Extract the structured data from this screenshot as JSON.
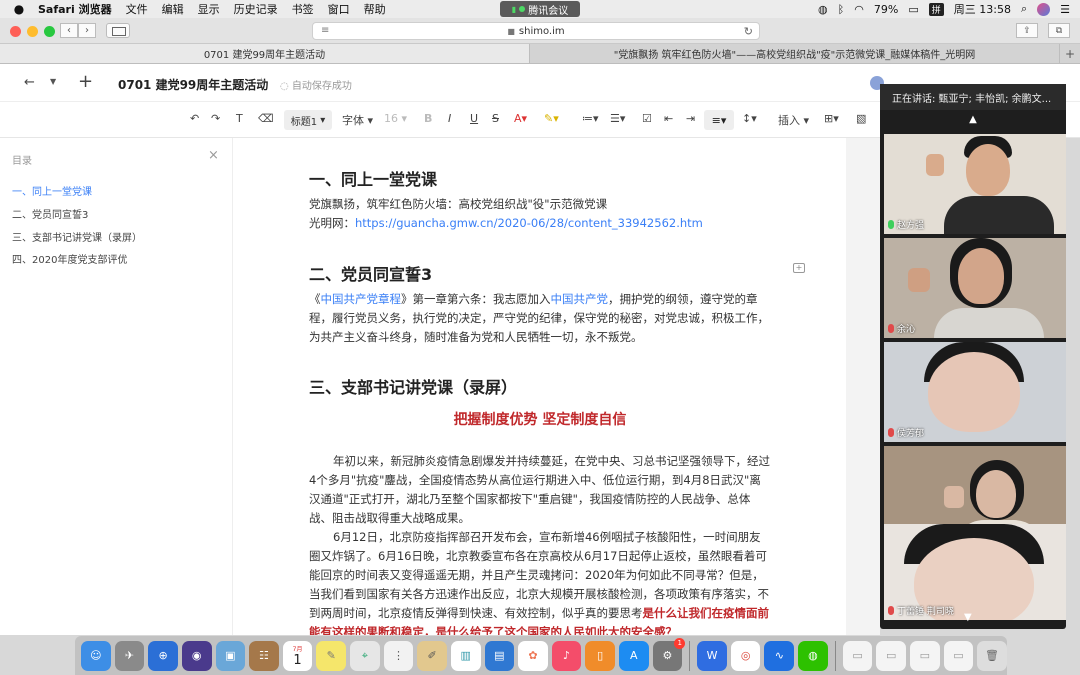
{
  "menubar": {
    "app_name": "Safari 浏览器",
    "items": [
      "文件",
      "编辑",
      "显示",
      "历史记录",
      "书签",
      "窗口",
      "帮助"
    ],
    "meeting_app": "腾讯会议",
    "battery": "79%",
    "input_method": "拼",
    "clock": "周三 13:58"
  },
  "safari": {
    "url": "shimo.im",
    "tabs": [
      {
        "title": "0701 建党99周年主题活动",
        "active": true
      },
      {
        "title": "\"党旗飘扬 筑牢红色防火墙\"——高校党组织战\"疫\"示范微党课_融媒体稿件_光明网",
        "active": false
      }
    ],
    "new_tab": "+"
  },
  "doc_header": {
    "title": "0701 建党99周年主题活动",
    "save_status": "自动保存成功"
  },
  "format_toolbar": {
    "style_select": "标题1",
    "font_select": "字体",
    "size_select": "16",
    "insert_label": "插入"
  },
  "outline": {
    "title": "目录",
    "items": [
      {
        "label": "一、同上一堂党课",
        "active": true
      },
      {
        "label": "二、党员同宣誓3",
        "active": false
      },
      {
        "label": "三、支部书记讲党课（录屏）",
        "active": false
      },
      {
        "label": "四、2020年度党支部评优",
        "active": false
      }
    ]
  },
  "document": {
    "h1": "一、同上一堂党课",
    "s1_line1": "党旗飘扬，筑牢红色防火墙：高校党组织战\"役\"示范微党课",
    "s1_line2_prefix": "光明网：",
    "s1_link": "https://guancha.gmw.cn/2020-06/28/content_33942562.htm",
    "h2": "二、党员同宣誓3",
    "s2_open": "《",
    "s2_link1": "中国共产党章程",
    "s2_mid1": "》第一章第六条：我志愿加入",
    "s2_link2": "中国共产党",
    "s2_rest": "，拥护党的纲领，遵守党的章程，履行党员义务，执行党的决定，严守党的纪律，保守党的秘密，对党忠诚，积极工作，为共产主义奋斗终身，随时准备为党和人民牺牲一切，永不叛党。",
    "h3": "三、支部书记讲党课（录屏）",
    "subtitle": "把握制度优势 坚定制度自信",
    "para1": "年初以来，新冠肺炎疫情急剧爆发并持续蔓延，在党中央、习总书记坚强领导下，经过4个多月\"抗疫\"鏖战，全国疫情态势从高位运行期进入中、低位运行期，到4月8日武汉\"离汉通道\"正式打开，湖北乃至整个国家都按下\"重启键\"，我国疫情防控的人民战争、总体战、阻击战取得重大战略成果。",
    "para2_plain": "6月12日，北京防疫指挥部召开发布会，宣布新增46例咽拭子核酸阳性，一时间朋友圈又炸锅了。6月16日晚，北京教委宣布各在京高校从6月17日起停止返校，虽然眼看着可能回京的时间表又变得遥遥无期，并且产生灵魂拷问：2020年为何如此不同寻常？但是，当我们看到国家有关各方迅速作出反应，北京大规模开展核酸检测，各项政策有序落实，不到两周时间，北京疫情反弹得到快速、有效控制，似乎真的要思考",
    "para2_red": "是什么让我们在疫情面前能有这样的果断和稳定，是什么给予了这个国家的人民如此大的安全感？"
  },
  "meeting": {
    "speaking": "正在讲话: 甄亚宁; 丰怡凯; 余鹏文...",
    "participants": [
      {
        "name": "赵方强",
        "mic": "on"
      },
      {
        "name": "余沁",
        "mic": "off"
      },
      {
        "name": "侯芳郁",
        "mic": "off"
      },
      {
        "name": "姜润",
        "mic": "on"
      },
      {
        "name": "丁蕾锤 荆司晓",
        "mic": "off"
      }
    ]
  },
  "dock": {
    "calendar_month": "7月",
    "calendar_day": "1",
    "badge_count": "1"
  }
}
